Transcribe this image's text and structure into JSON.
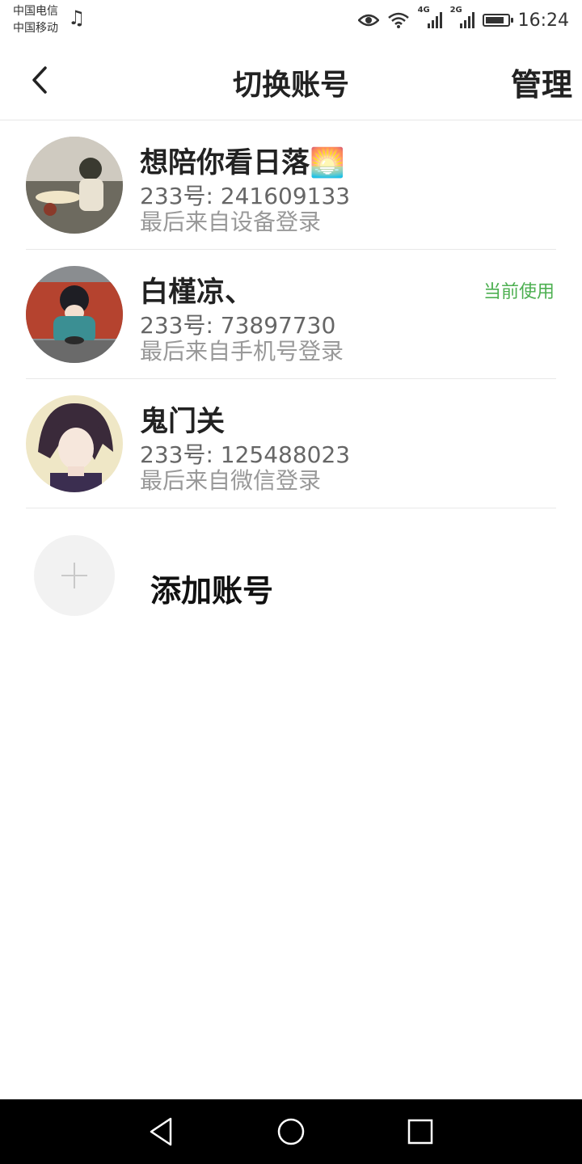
{
  "status_bar": {
    "carrier_1": "中国电信",
    "carrier_2": "中国移动",
    "net_1": "4G",
    "net_2": "2G",
    "time": "16:24",
    "battery_level": 0.85
  },
  "header": {
    "title": "切换账号",
    "manage_label": "管理"
  },
  "accounts": [
    {
      "name": "想陪你看日落🌅",
      "number": "233号: 241609133",
      "login": "最后来自设备登录",
      "current": ""
    },
    {
      "name": "白槿凉、",
      "number": "233号: 73897730",
      "login": "最后来自手机号登录",
      "current": "当前使用"
    },
    {
      "name": "鬼门关",
      "number": "233号: 125488023",
      "login": "最后来自微信登录",
      "current": ""
    }
  ],
  "add_account": {
    "label": "添加账号"
  },
  "colors": {
    "accent_green": "#4caf50",
    "divider": "#e8e8e8"
  }
}
